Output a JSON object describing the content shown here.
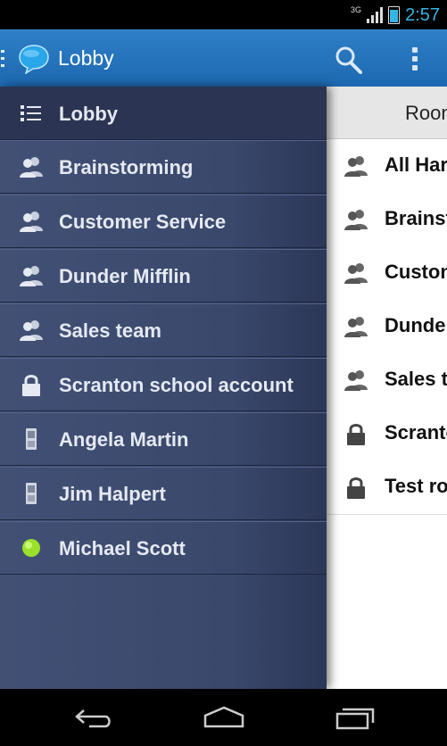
{
  "status_bar": {
    "network": "3G",
    "time": "2:57"
  },
  "action_bar": {
    "title": "Lobby",
    "icons": [
      "drawer-indicator-icon",
      "chat-bubble-logo-icon",
      "search-icon",
      "overflow-menu-icon"
    ]
  },
  "drawer": {
    "items": [
      {
        "label": "Lobby",
        "icon": "list-icon",
        "selected": true
      },
      {
        "label": "Brainstorming",
        "icon": "group-icon"
      },
      {
        "label": "Customer Service",
        "icon": "group-icon"
      },
      {
        "label": "Dunder Mifflin",
        "icon": "group-icon"
      },
      {
        "label": "Sales team",
        "icon": "group-icon"
      },
      {
        "label": "Scranton school account",
        "icon": "lock-icon"
      },
      {
        "label": "Angela Martin",
        "icon": "mobile-phone-icon"
      },
      {
        "label": "Jim Halpert",
        "icon": "mobile-phone-icon"
      },
      {
        "label": "Michael Scott",
        "icon": "online-status-icon"
      }
    ]
  },
  "content": {
    "header": "Roon",
    "rows": [
      {
        "label": "All Har",
        "icon": "group-icon"
      },
      {
        "label": "Brainst",
        "icon": "group-icon"
      },
      {
        "label": "Custon",
        "icon": "group-icon"
      },
      {
        "label": "Dunder",
        "icon": "group-icon"
      },
      {
        "label": "Sales t",
        "icon": "group-icon"
      },
      {
        "label": "Scranto",
        "icon": "lock-icon"
      },
      {
        "label": "Test ro",
        "icon": "lock-icon"
      }
    ]
  },
  "nav_bar": {
    "icons": [
      "back-icon",
      "home-icon",
      "recent-apps-icon"
    ]
  },
  "colors": {
    "action_bar": "#1d68b0",
    "drawer": "#3a486c",
    "status_accent": "#33b5e5",
    "online": "#9be02a"
  }
}
